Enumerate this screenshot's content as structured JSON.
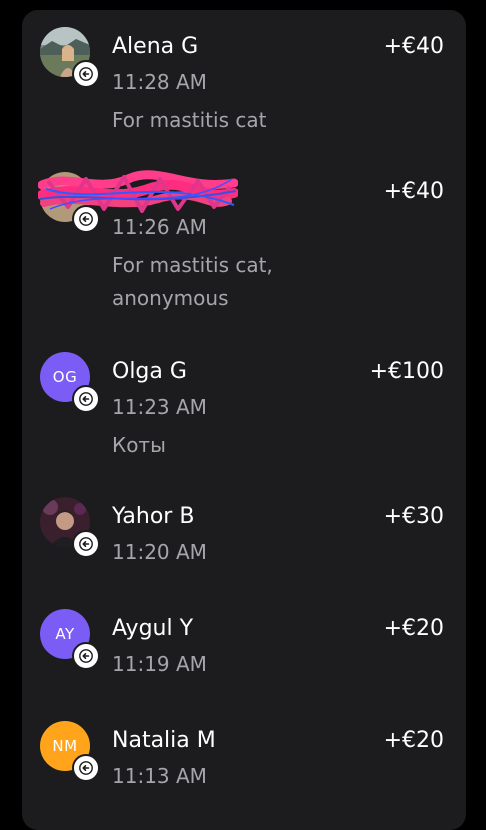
{
  "transactions": [
    {
      "name": "Alena G",
      "time": "11:28 AM",
      "amount": "+€40",
      "note": "For mastitis cat",
      "avatar": "photo",
      "badge_icon": "arrow-left-icon"
    },
    {
      "name": "",
      "time": "11:26 AM",
      "amount": "+€40",
      "note": "For mastitis cat, anonymous",
      "avatar": "photo",
      "badge_icon": "arrow-left-icon",
      "name_redacted": true
    },
    {
      "name": "Olga G",
      "time": "11:23 AM",
      "amount": "+€100",
      "note": "Коты",
      "avatar": "initials",
      "initials": "OG",
      "avatar_color": "#7b5cf5",
      "badge_icon": "arrow-left-icon"
    },
    {
      "name": "Yahor B",
      "time": "11:20 AM",
      "amount": "+€30",
      "avatar": "photo",
      "badge_icon": "arrow-left-icon"
    },
    {
      "name": "Aygul Y",
      "time": "11:19 AM",
      "amount": "+€20",
      "avatar": "initials",
      "initials": "AY",
      "avatar_color": "#7b5cf5",
      "badge_icon": "arrow-left-icon"
    },
    {
      "name": "Natalia M",
      "time": "11:13 AM",
      "amount": "+€20",
      "avatar": "initials",
      "initials": "NM",
      "avatar_color": "#ffa41b",
      "badge_icon": "arrow-left-icon"
    }
  ],
  "colors": {
    "background": "#000000",
    "card": "#1c1c1e",
    "text_primary": "#ffffff",
    "text_secondary": "#a5a5aa"
  }
}
